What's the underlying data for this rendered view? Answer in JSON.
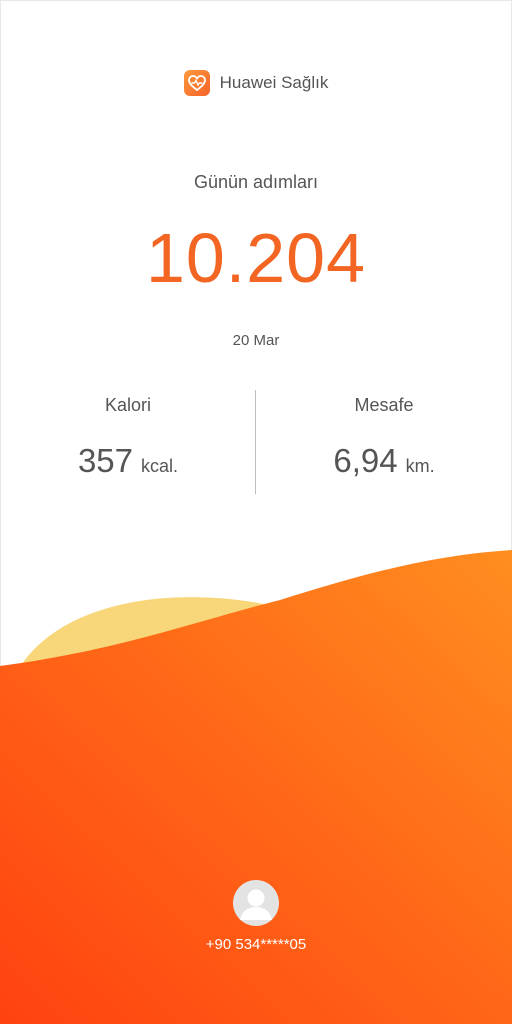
{
  "app": {
    "name": "Huawei Sağlık",
    "icon": "heart-health-icon"
  },
  "steps": {
    "label": "Günün adımları",
    "value": "10.204"
  },
  "date": "20 Mar",
  "stats": {
    "calories": {
      "label": "Kalori",
      "value": "357",
      "unit": "kcal."
    },
    "distance": {
      "label": "Mesafe",
      "value": "6,94",
      "unit": "km."
    }
  },
  "user": {
    "avatar_icon": "user-avatar-icon",
    "phone": "+90 534*****05"
  },
  "colors": {
    "accent": "#f26522",
    "wave_orange_start": "#ff4a14",
    "wave_orange_end": "#ff8a1f",
    "sun_yellow": "#f8d77a"
  }
}
